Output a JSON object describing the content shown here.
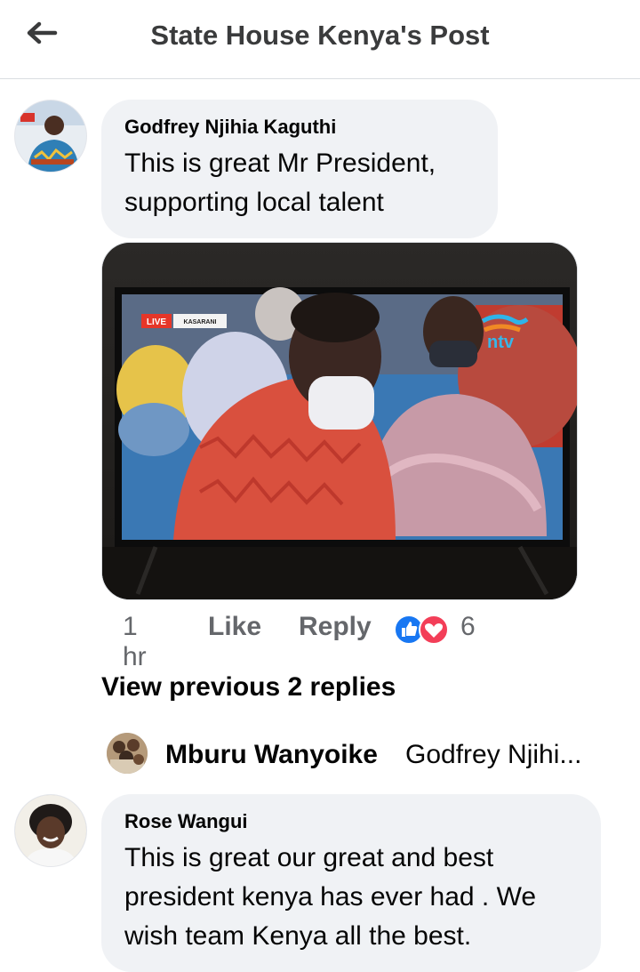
{
  "header": {
    "title": "State House Kenya's Post",
    "back_icon": "back-arrow-icon"
  },
  "comments": [
    {
      "author": "Godfrey Njihia Kaguthi",
      "text_line1": "This is great Mr President,",
      "text_line2": "supporting local talent",
      "media": {
        "live_badge": "LIVE",
        "location_badge": "KASARANI",
        "channel_logo": "ntv"
      },
      "time": "1 hr",
      "like_label": "Like",
      "reply_label": "Reply",
      "reactions": {
        "icons": [
          "like-icon",
          "love-icon"
        ],
        "count": "6"
      }
    },
    {
      "author": "Rose Wangui",
      "text_line1": "This is great our great and best",
      "text_line2": "president kenya has ever had . We",
      "text_line3": "wish team Kenya all the best."
    }
  ],
  "replies": {
    "view_previous_label": "View previous 2 replies",
    "latest": {
      "author": "Mburu Wanyoike",
      "snippet": "Godfrey Njihi..."
    }
  },
  "colors": {
    "bubble": "#f0f2f5",
    "like_blue": "#1877f2",
    "love_red": "#f33e58",
    "secondary_text": "#65676b"
  }
}
